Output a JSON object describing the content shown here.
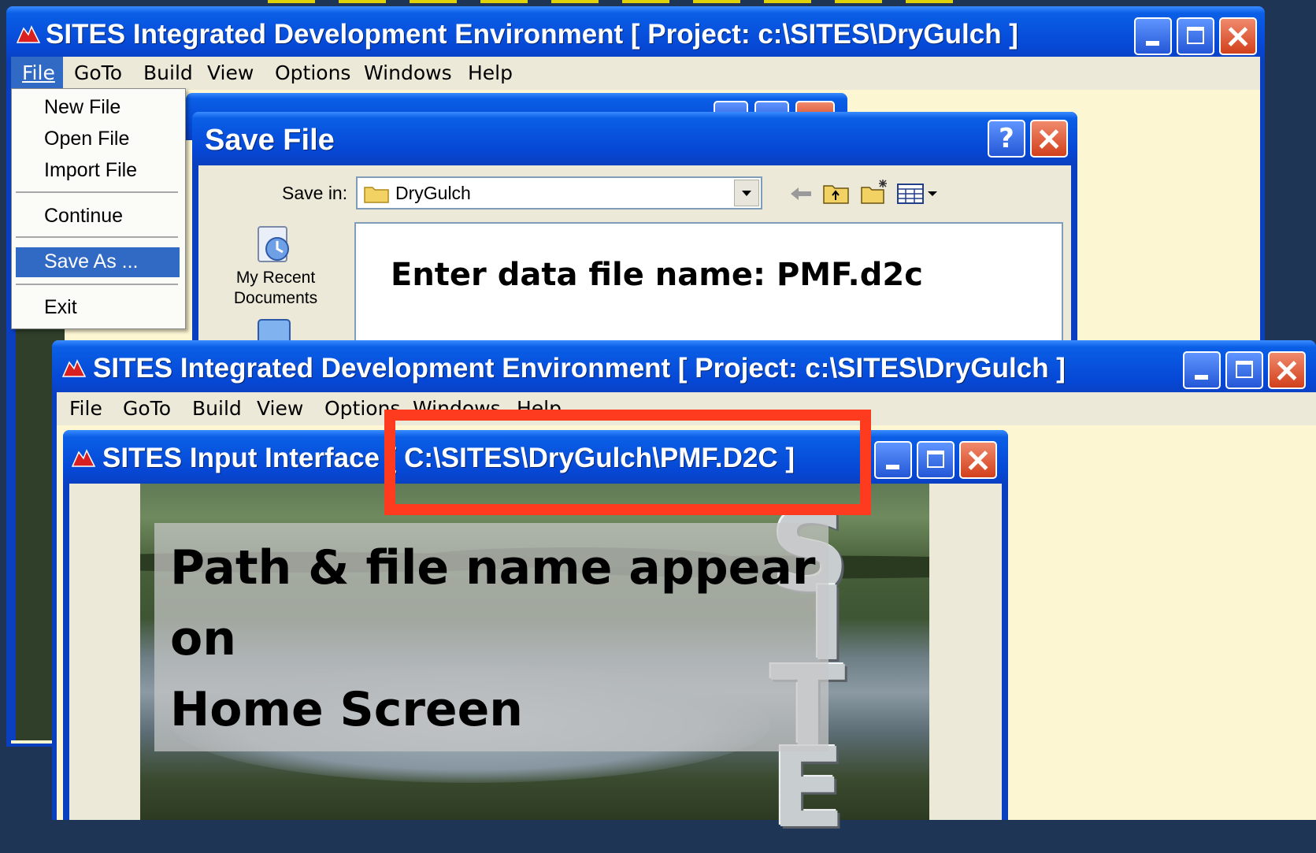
{
  "window1": {
    "title": "SITES Integrated Development Environment [ Project: c:\\SITES\\DryGulch ]",
    "menu": [
      "File",
      "GoTo",
      "Build",
      "View",
      "Options",
      "Windows",
      "Help"
    ]
  },
  "file_menu": {
    "items": [
      "New File",
      "Open File",
      "Import File",
      "Continue",
      "Save As ...",
      "Exit"
    ],
    "selected": "Save As ..."
  },
  "save_dialog": {
    "title": "Save File",
    "help_label": "?",
    "save_in_label": "Save in:",
    "save_in_value": "DryGulch",
    "places": [
      {
        "label": "My Recent Documents",
        "icon": "recent-documents-icon"
      }
    ],
    "callout": "Enter data file name: PMF.d2c"
  },
  "window2": {
    "title": "SITES Integrated Development Environment [ Project: c:\\SITES\\DryGulch ]",
    "menu": [
      "File",
      "GoTo",
      "Build",
      "View",
      "Options",
      "Windows",
      "Help"
    ]
  },
  "input_interface": {
    "title": "SITES Input Interface [ C:\\SITES\\DryGulch\\PMF.D2C ]",
    "callout_lines": [
      "Path & file name appear",
      "on",
      "Home Screen"
    ],
    "logo_letters": [
      "S",
      "I",
      "T",
      "E"
    ]
  },
  "colors": {
    "background": "#1f3556",
    "highlight": "#ff3b1f",
    "menu_select": "#316ac5",
    "workspace": "#fdf6d3"
  }
}
